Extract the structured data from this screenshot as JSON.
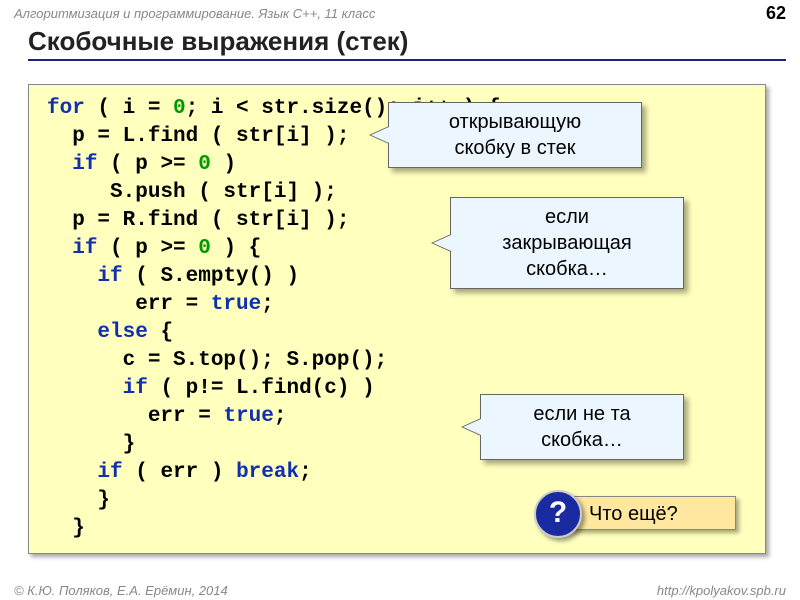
{
  "header": {
    "course": "Алгоритмизация и программирование. Язык C++, 11 класс",
    "page": "62"
  },
  "title": "Скобочные выражения (стек)",
  "code": {
    "l1a": "for",
    "l1b": " ( i = ",
    "l1c": "0",
    "l1d": "; i < str.size(); i++ ) {",
    "l2": "  p = L.find ( str[i] );",
    "l3a": "  ",
    "l3b": "if",
    "l3c": " ( p >= ",
    "l3d": "0",
    "l3e": " )",
    "l4": "     S.push ( str[i] );",
    "l5": "  p = R.find ( str[i] );",
    "l6a": "  ",
    "l6b": "if",
    "l6c": " ( p >= ",
    "l6d": "0",
    "l6e": " ) {",
    "l7a": "    ",
    "l7b": "if",
    "l7c": " ( S.empty() )",
    "l8a": "       err = ",
    "l8b": "true",
    "l8c": ";",
    "l9a": "    ",
    "l9b": "else",
    "l9c": " {",
    "l10": "      c = S.top(); S.pop();",
    "l11a": "      ",
    "l11b": "if",
    "l11c": " ( p!= L.find(c) )",
    "l12a": "        err = ",
    "l12b": "true",
    "l12c": ";",
    "l13": "      }",
    "l14a": "    ",
    "l14b": "if",
    "l14c": " ( err ) ",
    "l14d": "break",
    "l14e": ";",
    "l15": "    }",
    "l16": "  }"
  },
  "callouts": {
    "c1_l1": "открывающую",
    "c1_l2": "скобку в стек",
    "c2_l1": "если",
    "c2_l2": "закрывающая",
    "c2_l3": "скобка…",
    "c3_l1": "если не та",
    "c3_l2": "скобка…"
  },
  "question": {
    "mark": "?",
    "text": "Что ещё?"
  },
  "footer": {
    "left": "© К.Ю. Поляков, Е.А. Ерёмин, 2014",
    "right": "http://kpolyakov.spb.ru"
  }
}
